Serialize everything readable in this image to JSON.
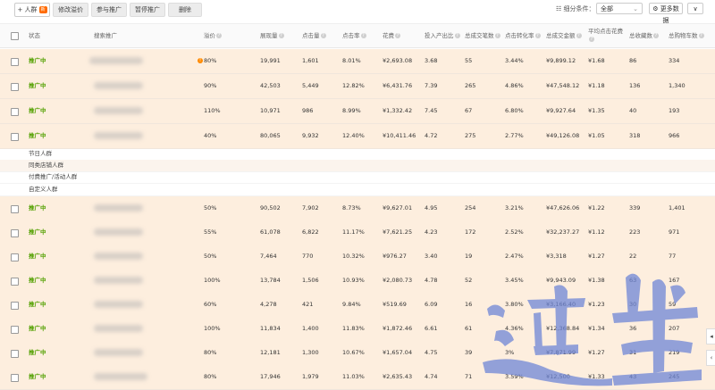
{
  "toolbar": {
    "add_crowd": "+ 人群",
    "new_badge": "新",
    "modify_bid": "修改溢价",
    "join_promo": "参与推广",
    "pause_promo": "暂停推广",
    "delete": "删除",
    "segment_label": "细分条件：",
    "segment_value": "全部",
    "more_data": "更多数据",
    "collapse": "∨"
  },
  "columns": [
    "状态",
    "搜索推广",
    "溢价",
    "展现量",
    "点击量",
    "点击率",
    "花费",
    "投入产出比",
    "总成交笔数",
    "点击转化率",
    "总成交金额",
    "平均点击花费",
    "总收藏数",
    "总购物车数"
  ],
  "groups": [
    "节日人群",
    "同类店铺人群",
    "付费推广/活动人群",
    "自定义人群"
  ],
  "rows_top": [
    {
      "status": "推广中",
      "warn": true,
      "bid": "80%",
      "impr": "19,991",
      "clicks": "1,601",
      "ctr": "8.01%",
      "cost": "¥2,693.08",
      "roi": "3.68",
      "orders": "55",
      "cvr": "3.44%",
      "gmv": "¥9,899.12",
      "cpc": "¥1.68",
      "fav": "86",
      "cart": "334"
    },
    {
      "status": "推广中",
      "warn": false,
      "bid": "90%",
      "impr": "42,503",
      "clicks": "5,449",
      "ctr": "12.82%",
      "cost": "¥6,431.76",
      "roi": "7.39",
      "orders": "265",
      "cvr": "4.86%",
      "gmv": "¥47,548.12",
      "cpc": "¥1.18",
      "fav": "136",
      "cart": "1,340"
    },
    {
      "status": "推广中",
      "warn": false,
      "bid": "110%",
      "impr": "10,971",
      "clicks": "986",
      "ctr": "8.99%",
      "cost": "¥1,332.42",
      "roi": "7.45",
      "orders": "67",
      "cvr": "6.80%",
      "gmv": "¥9,927.64",
      "cpc": "¥1.35",
      "fav": "40",
      "cart": "193"
    },
    {
      "status": "推广中",
      "warn": false,
      "bid": "40%",
      "impr": "80,065",
      "clicks": "9,932",
      "ctr": "12.40%",
      "cost": "¥10,411.46",
      "roi": "4.72",
      "orders": "275",
      "cvr": "2.77%",
      "gmv": "¥49,126.08",
      "cpc": "¥1.05",
      "fav": "318",
      "cart": "966"
    }
  ],
  "rows_bottom": [
    {
      "status": "推广中",
      "bid": "50%",
      "impr": "90,502",
      "clicks": "7,902",
      "ctr": "8.73%",
      "cost": "¥9,627.01",
      "roi": "4.95",
      "orders": "254",
      "cvr": "3.21%",
      "gmv": "¥47,626.06",
      "cpc": "¥1.22",
      "fav": "339",
      "cart": "1,401"
    },
    {
      "status": "推广中",
      "bid": "55%",
      "impr": "61,078",
      "clicks": "6,822",
      "ctr": "11.17%",
      "cost": "¥7,621.25",
      "roi": "4.23",
      "orders": "172",
      "cvr": "2.52%",
      "gmv": "¥32,237.27",
      "cpc": "¥1.12",
      "fav": "223",
      "cart": "971"
    },
    {
      "status": "推广中",
      "bid": "50%",
      "impr": "7,464",
      "clicks": "770",
      "ctr": "10.32%",
      "cost": "¥976.27",
      "roi": "3.40",
      "orders": "19",
      "cvr": "2.47%",
      "gmv": "¥3,318",
      "cpc": "¥1.27",
      "fav": "22",
      "cart": "77"
    },
    {
      "status": "推广中",
      "bid": "100%",
      "impr": "13,784",
      "clicks": "1,506",
      "ctr": "10.93%",
      "cost": "¥2,080.73",
      "roi": "4.78",
      "orders": "52",
      "cvr": "3.45%",
      "gmv": "¥9,943.09",
      "cpc": "¥1.38",
      "fav": "63",
      "cart": "167"
    },
    {
      "status": "推广中",
      "bid": "60%",
      "impr": "4,278",
      "clicks": "421",
      "ctr": "9.84%",
      "cost": "¥519.69",
      "roi": "6.09",
      "orders": "16",
      "cvr": "3.80%",
      "gmv": "¥3,166.40",
      "cpc": "¥1.23",
      "fav": "30",
      "cart": "59"
    },
    {
      "status": "推广中",
      "bid": "100%",
      "impr": "11,834",
      "clicks": "1,400",
      "ctr": "11.83%",
      "cost": "¥1,872.46",
      "roi": "6.61",
      "orders": "61",
      "cvr": "4.36%",
      "gmv": "¥12,368.84",
      "cpc": "¥1.34",
      "fav": "36",
      "cart": "207"
    },
    {
      "status": "推广中",
      "bid": "80%",
      "impr": "12,181",
      "clicks": "1,300",
      "ctr": "10.67%",
      "cost": "¥1,657.04",
      "roi": "4.75",
      "orders": "39",
      "cvr": "3%",
      "gmv": "¥7,871.99",
      "cpc": "¥1.27",
      "fav": "31",
      "cart": "219"
    },
    {
      "status": "推广中",
      "bid": "80%",
      "impr": "17,946",
      "clicks": "1,979",
      "ctr": "11.03%",
      "cost": "¥2,635.43",
      "roi": "4.74",
      "orders": "71",
      "cvr": "3.59%",
      "gmv": "¥12,500",
      "cpc": "¥1.33",
      "fav": "43",
      "cart": "245"
    }
  ],
  "watermark_text": "迎 尘",
  "colors": {
    "highlight_row": "#fdeede",
    "status_green": "#52a000",
    "watermark": "#6f86d6"
  }
}
